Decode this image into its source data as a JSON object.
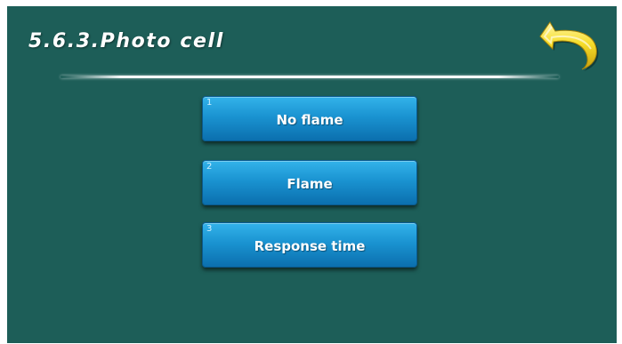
{
  "header": {
    "title": "5.6.3.Photo cell",
    "back_icon": "back-arrow-icon"
  },
  "menu": {
    "items": [
      {
        "number": "1",
        "label": "No flame"
      },
      {
        "number": "2",
        "label": "Flame"
      },
      {
        "number": "3",
        "label": "Response time"
      }
    ]
  },
  "colors": {
    "background": "#1d5e58",
    "button": "#1a93d1",
    "back_arrow": "#f2d21e",
    "text": "#ffffff"
  }
}
